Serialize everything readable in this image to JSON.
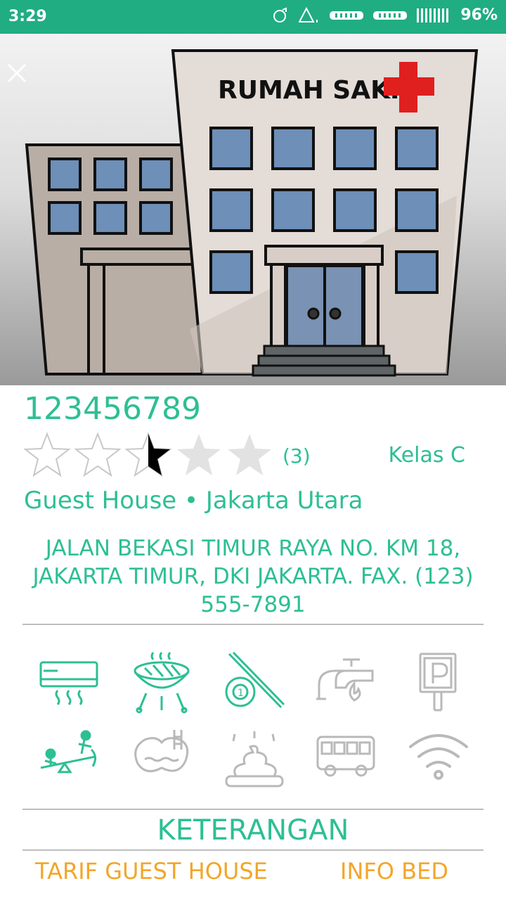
{
  "status_bar": {
    "time": "3:29",
    "battery": "96%"
  },
  "hero": {
    "sign": "RUMAH SAKIT"
  },
  "facility": {
    "name": "123456789",
    "rating": 2.5,
    "rating_max": 5,
    "review_count": "(3)",
    "class": "Kelas C",
    "category": "Guest House • Jakarta Utara",
    "address": "JALAN BEKASI TIMUR RAYA NO. KM 18, JAKARTA TIMUR, DKI JAKARTA. FAX. (123) 555-7891"
  },
  "amenities": [
    {
      "icon": "air-conditioner-icon",
      "active": true
    },
    {
      "icon": "barbecue-grill-icon",
      "active": true
    },
    {
      "icon": "billiard-icon",
      "active": true
    },
    {
      "icon": "hot-water-tap-icon",
      "active": false
    },
    {
      "icon": "parking-icon",
      "active": false
    },
    {
      "icon": "playground-seesaw-icon",
      "active": true
    },
    {
      "icon": "swimming-pool-icon",
      "active": false
    },
    {
      "icon": "toilet-icon",
      "active": false
    },
    {
      "icon": "bus-icon",
      "active": false
    },
    {
      "icon": "wifi-icon",
      "active": false
    }
  ],
  "sections": {
    "keterangan": "KETERANGAN",
    "tab_tarif": "TARIF GUEST HOUSE",
    "tab_info_bed": "INFO BED"
  },
  "colors": {
    "accent": "#20ad82",
    "text_green": "#2dbf94",
    "orange": "#f2a62a",
    "inactive": "#b9b9b9"
  }
}
